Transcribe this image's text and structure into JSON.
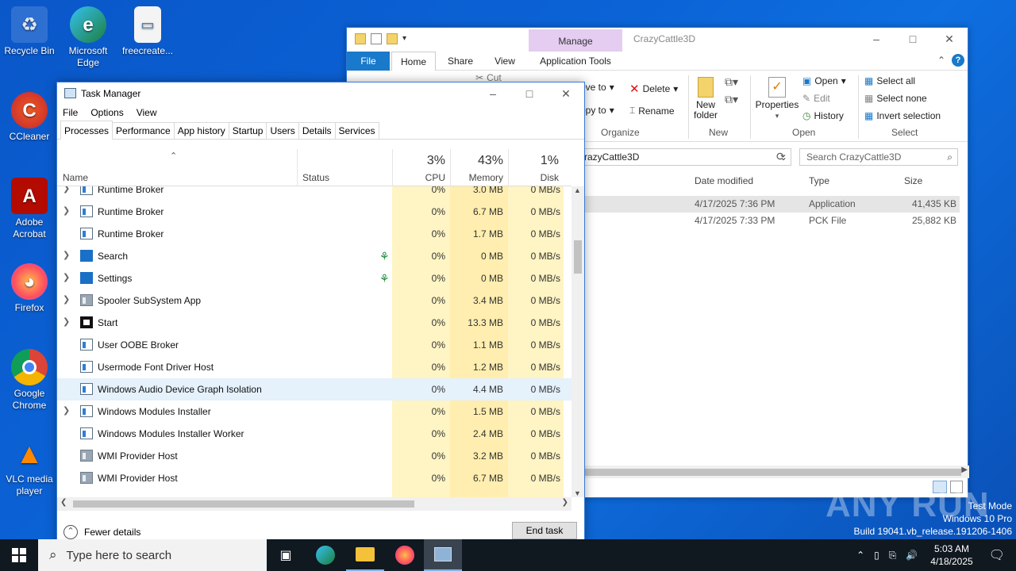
{
  "desktop": {
    "icons": [
      {
        "label": "Recycle Bin"
      },
      {
        "label": "Microsoft Edge"
      },
      {
        "label": "freecreate..."
      },
      {
        "label": "CCleaner"
      },
      {
        "label": "Adobe Acrobat"
      },
      {
        "label": "Firefox"
      },
      {
        "label": "Google Chrome"
      },
      {
        "label": "VLC media player"
      }
    ]
  },
  "explorer": {
    "manage_label": "Manage",
    "window_title": "CrazyCattle3D",
    "tabs": {
      "file": "File",
      "home": "Home",
      "share": "Share",
      "view": "View",
      "app_tools": "Application Tools"
    },
    "ribbon": {
      "cut": "Cut",
      "move_to": "ove to",
      "copy_to": "opy to",
      "delete": "Delete",
      "rename": "Rename",
      "organize": "Organize",
      "new_folder_1": "New",
      "new_folder_2": "folder",
      "new": "New",
      "properties": "Properties",
      "open": "Open",
      "edit": "Edit",
      "history": "History",
      "open_group": "Open",
      "select_all": "Select all",
      "select_none": "Select none",
      "invert_selection": "Invert selection",
      "select_group": "Select"
    },
    "address": "razyCattle3D",
    "search_placeholder": "Search CrazyCattle3D",
    "columns": {
      "date": "Date modified",
      "type": "Type",
      "size": "Size"
    },
    "files": [
      {
        "date": "4/17/2025 7:36 PM",
        "type": "Application",
        "size": "41,435 KB"
      },
      {
        "date": "4/17/2025 7:33 PM",
        "type": "PCK File",
        "size": "25,882 KB"
      }
    ]
  },
  "taskmanager": {
    "title": "Task Manager",
    "menu": [
      "File",
      "Options",
      "View"
    ],
    "tabs": [
      "Processes",
      "Performance",
      "App history",
      "Startup",
      "Users",
      "Details",
      "Services"
    ],
    "header": {
      "name": "Name",
      "status": "Status",
      "cpu_pct": "3%",
      "cpu": "CPU",
      "mem_pct": "43%",
      "mem": "Memory",
      "disk_pct": "1%",
      "disk": "Disk"
    },
    "rows": [
      {
        "name": "Runtime Broker",
        "cpu": "0%",
        "mem": "3.0 MB",
        "disk": "0 MB/s"
      },
      {
        "name": "Runtime Broker",
        "cpu": "0%",
        "mem": "6.7 MB",
        "disk": "0 MB/s"
      },
      {
        "name": "Runtime Broker",
        "cpu": "0%",
        "mem": "1.7 MB",
        "disk": "0 MB/s"
      },
      {
        "name": "Search",
        "cpu": "0%",
        "mem": "0 MB",
        "disk": "0 MB/s"
      },
      {
        "name": "Settings",
        "cpu": "0%",
        "mem": "0 MB",
        "disk": "0 MB/s"
      },
      {
        "name": "Spooler SubSystem App",
        "cpu": "0%",
        "mem": "3.4 MB",
        "disk": "0 MB/s"
      },
      {
        "name": "Start",
        "cpu": "0%",
        "mem": "13.3 MB",
        "disk": "0 MB/s"
      },
      {
        "name": "User OOBE Broker",
        "cpu": "0%",
        "mem": "1.1 MB",
        "disk": "0 MB/s"
      },
      {
        "name": "Usermode Font Driver Host",
        "cpu": "0%",
        "mem": "1.2 MB",
        "disk": "0 MB/s"
      },
      {
        "name": "Windows Audio Device Graph Isolation",
        "cpu": "0%",
        "mem": "4.4 MB",
        "disk": "0 MB/s"
      },
      {
        "name": "Windows Modules Installer",
        "cpu": "0%",
        "mem": "1.5 MB",
        "disk": "0 MB/s"
      },
      {
        "name": "Windows Modules Installer Worker",
        "cpu": "0%",
        "mem": "2.4 MB",
        "disk": "0 MB/s"
      },
      {
        "name": "WMI Provider Host",
        "cpu": "0%",
        "mem": "3.2 MB",
        "disk": "0 MB/s"
      },
      {
        "name": "WMI Provider Host",
        "cpu": "0%",
        "mem": "6.7 MB",
        "disk": "0 MB/s"
      }
    ],
    "fewer_details": "Fewer details",
    "end_task": "End task"
  },
  "watermark": {
    "brand": "ANY RUN",
    "line1": "Test Mode",
    "line2": "Windows 10 Pro",
    "line3": "Build 19041.vb_release.191206-1406"
  },
  "taskbar": {
    "search_placeholder": "Type here to search",
    "time": "5:03 AM",
    "date": "4/18/2025"
  },
  "colors": {
    "accent": "#1979ca",
    "heat": "#fff4c4",
    "selected": "#e5f1fb"
  }
}
